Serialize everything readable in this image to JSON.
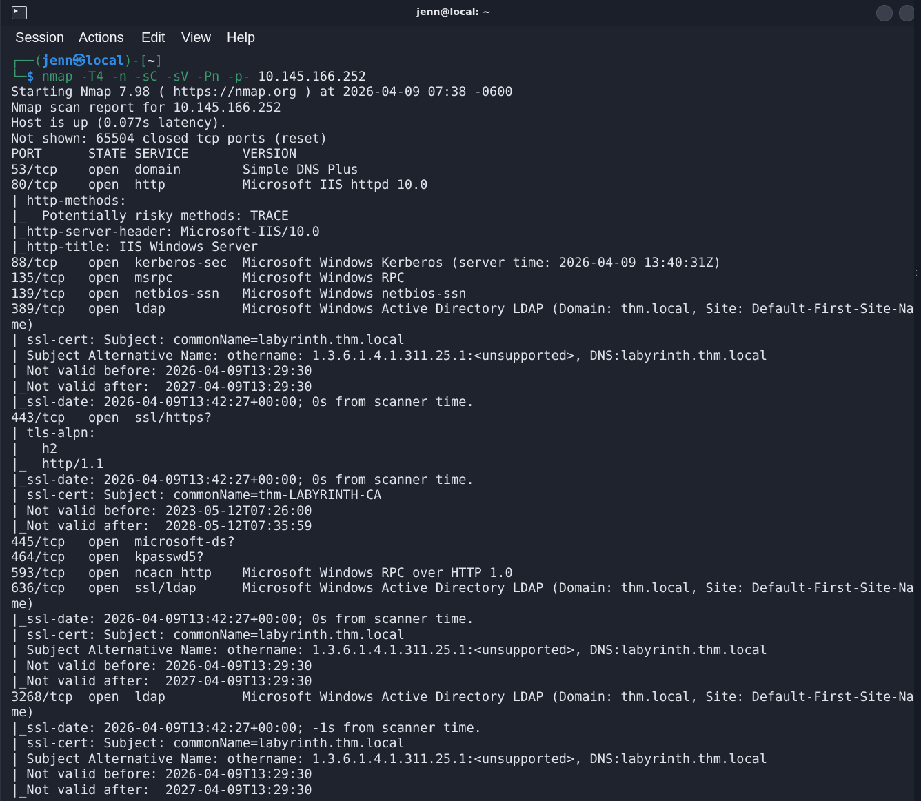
{
  "window": {
    "title": "jenn@local: ~"
  },
  "menu": {
    "items": [
      "Session",
      "Actions",
      "Edit",
      "View",
      "Help"
    ]
  },
  "prompt": {
    "frame_top_left": "┌──(",
    "user_host": "jenn㉿local",
    "frame_mid": ")-[",
    "path": "~",
    "frame_end": "]",
    "frame_bottom": "└─",
    "dollar": "$",
    "command": "nmap -T4 -n -sC -sV -Pn -p-",
    "target": "10.145.166.252"
  },
  "output": [
    "Starting Nmap 7.98 ( https://nmap.org ) at 2026-04-09 07:38 -0600",
    "Nmap scan report for 10.145.166.252",
    "Host is up (0.077s latency).",
    "Not shown: 65504 closed tcp ports (reset)",
    "PORT      STATE SERVICE       VERSION",
    "53/tcp    open  domain        Simple DNS Plus",
    "80/tcp    open  http          Microsoft IIS httpd 10.0",
    "| http-methods:",
    "|_  Potentially risky methods: TRACE",
    "|_http-server-header: Microsoft-IIS/10.0",
    "|_http-title: IIS Windows Server",
    "88/tcp    open  kerberos-sec  Microsoft Windows Kerberos (server time: 2026-04-09 13:40:31Z)",
    "135/tcp   open  msrpc         Microsoft Windows RPC",
    "139/tcp   open  netbios-ssn   Microsoft Windows netbios-ssn",
    "389/tcp   open  ldap          Microsoft Windows Active Directory LDAP (Domain: thm.local, Site: Default-First-Site-Na",
    "me)",
    "| ssl-cert: Subject: commonName=labyrinth.thm.local",
    "| Subject Alternative Name: othername: 1.3.6.1.4.1.311.25.1:<unsupported>, DNS:labyrinth.thm.local",
    "| Not valid before: 2026-04-09T13:29:30",
    "|_Not valid after:  2027-04-09T13:29:30",
    "|_ssl-date: 2026-04-09T13:42:27+00:00; 0s from scanner time.",
    "443/tcp   open  ssl/https?",
    "| tls-alpn:",
    "|   h2",
    "|_  http/1.1",
    "|_ssl-date: 2026-04-09T13:42:27+00:00; 0s from scanner time.",
    "| ssl-cert: Subject: commonName=thm-LABYRINTH-CA",
    "| Not valid before: 2023-05-12T07:26:00",
    "|_Not valid after:  2028-05-12T07:35:59",
    "445/tcp   open  microsoft-ds?",
    "464/tcp   open  kpasswd5?",
    "593/tcp   open  ncacn_http    Microsoft Windows RPC over HTTP 1.0",
    "636/tcp   open  ssl/ldap      Microsoft Windows Active Directory LDAP (Domain: thm.local, Site: Default-First-Site-Na",
    "me)",
    "|_ssl-date: 2026-04-09T13:42:27+00:00; 0s from scanner time.",
    "| ssl-cert: Subject: commonName=labyrinth.thm.local",
    "| Subject Alternative Name: othername: 1.3.6.1.4.1.311.25.1:<unsupported>, DNS:labyrinth.thm.local",
    "| Not valid before: 2026-04-09T13:29:30",
    "|_Not valid after:  2027-04-09T13:29:30",
    "3268/tcp  open  ldap          Microsoft Windows Active Directory LDAP (Domain: thm.local, Site: Default-First-Site-Na",
    "me)",
    "|_ssl-date: 2026-04-09T13:42:27+00:00; -1s from scanner time.",
    "| ssl-cert: Subject: commonName=labyrinth.thm.local",
    "| Subject Alternative Name: othername: 1.3.6.1.4.1.311.25.1:<unsupported>, DNS:labyrinth.thm.local",
    "| Not valid before: 2026-04-09T13:29:30",
    "|_Not valid after:  2027-04-09T13:29:30"
  ],
  "icons": {
    "app": "terminal-icon",
    "window_controls": [
      "minimize-button-icon",
      "close-button-icon"
    ]
  },
  "colors": {
    "background": "#1f232e",
    "text": "#dfe2e8",
    "prompt_user": "#2f8fe8",
    "prompt_frame": "#3b9a6d"
  }
}
